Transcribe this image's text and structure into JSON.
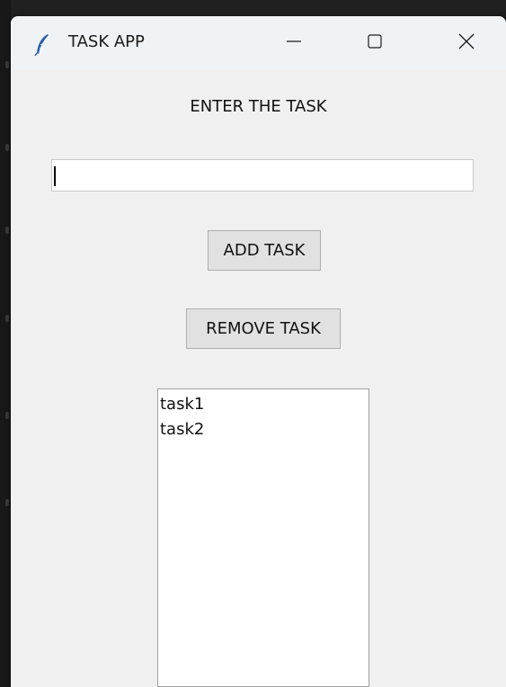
{
  "window": {
    "title": "TASK APP",
    "icon": "feather-icon",
    "controls": {
      "minimize": "minimize-icon",
      "maximize": "maximize-icon",
      "close": "close-icon"
    }
  },
  "form": {
    "heading": "ENTER THE TASK",
    "entry_value": "",
    "add_label": "ADD TASK",
    "remove_label": "REMOVE TASK"
  },
  "tasks": [
    {
      "label": "task1"
    },
    {
      "label": "task2"
    }
  ]
}
